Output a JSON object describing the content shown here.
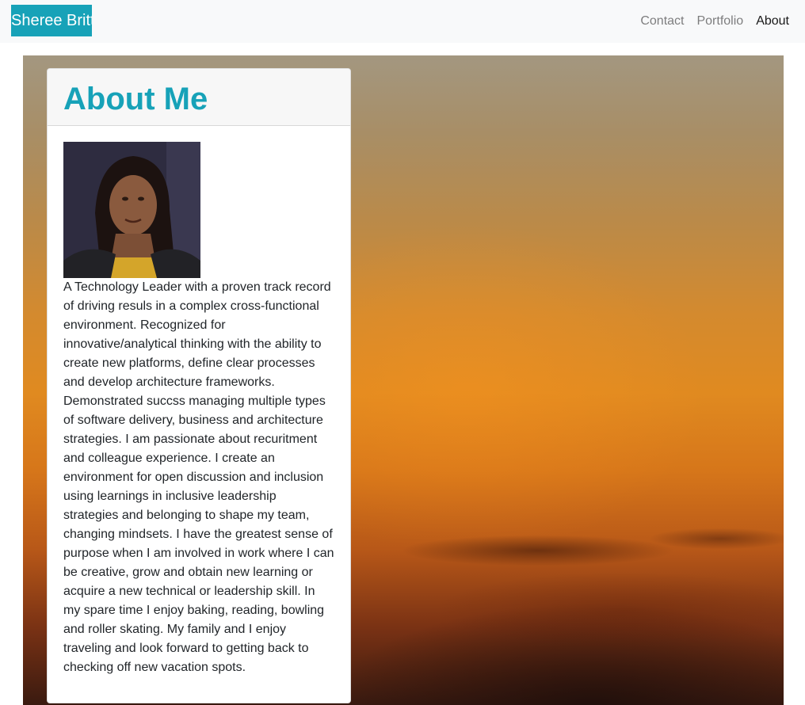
{
  "navbar": {
    "brand": "Sheree Britt",
    "links": [
      {
        "label": "Contact",
        "active": false
      },
      {
        "label": "Portfolio",
        "active": false
      },
      {
        "label": "About",
        "active": true
      }
    ]
  },
  "about": {
    "title": "About Me",
    "bio": "A Technology Leader with a proven track record of driving resuls in a complex cross-functional environment. Recognized for innovative/analytical thinking with the ability to create new platforms, define clear processes and develop architecture frameworks. Demonstrated succss managing multiple types of software delivery, business and architecture strategies. I am passionate about recuritment and colleague experience. I create an environment for open discussion and inclusion using learnings in inclusive leadership strategies and belonging to shape my team, changing mindsets. I have the greatest sense of purpose when I am involved in work where I can be creative, grow and obtain new learning or acquire a new technical or leadership skill. In my spare time I enjoy baking, reading, bowling and roller skating. My family and I enjoy traveling and look forward to getting back to checking off new vacation spots."
  },
  "colors": {
    "brand": "#17a2b8",
    "navbar_bg": "#f8f9fa",
    "card_header_bg": "#f7f7f7",
    "text": "#212529"
  }
}
